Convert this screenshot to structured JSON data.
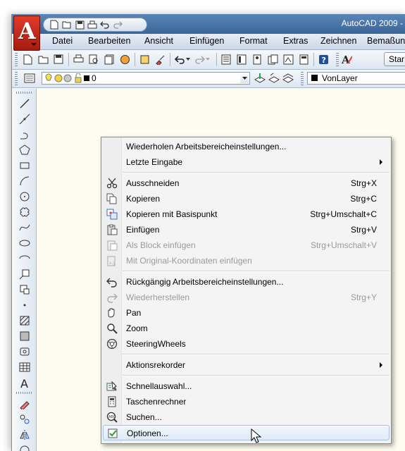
{
  "app_title": "AutoCAD 2009 -",
  "app_logo_letter": "A",
  "menu": [
    "Datei",
    "Bearbeiten",
    "Ansicht",
    "Einfügen",
    "Format",
    "Extras",
    "Zeichnen",
    "Bemaßun"
  ],
  "layer_toolbar": {
    "layer_value": "0",
    "color_value": "VonLayer"
  },
  "styles_button": "Star",
  "context_menu": {
    "items": [
      {
        "label": "Wiederholen Arbeitsbereicheinstellungen...",
        "shortcut": "",
        "icon": "",
        "submenu": false,
        "enabled": true
      },
      {
        "label": "Letzte Eingabe",
        "shortcut": "",
        "icon": "",
        "submenu": true,
        "enabled": true
      },
      {
        "label": "Ausschneiden",
        "shortcut": "Strg+X",
        "icon": "scissors-icon",
        "submenu": false,
        "enabled": true
      },
      {
        "label": "Kopieren",
        "shortcut": "Strg+C",
        "icon": "copy-icon",
        "submenu": false,
        "enabled": true
      },
      {
        "label": "Kopieren mit Basispunkt",
        "shortcut": "Strg+Umschalt+C",
        "icon": "copy-basepoint-icon",
        "submenu": false,
        "enabled": true
      },
      {
        "label": "Einfügen",
        "shortcut": "Strg+V",
        "icon": "paste-icon",
        "submenu": false,
        "enabled": true
      },
      {
        "label": "Als Block einfügen",
        "shortcut": "Strg+Umschalt+V",
        "icon": "paste-block-icon",
        "submenu": false,
        "enabled": false
      },
      {
        "label": "Mit Original-Koordinaten einfügen",
        "shortcut": "",
        "icon": "paste-original-coords-icon",
        "submenu": false,
        "enabled": false
      },
      {
        "label": "Rückgängig Arbeitsbereicheinstellungen...",
        "shortcut": "",
        "icon": "undo-icon",
        "submenu": false,
        "enabled": true
      },
      {
        "label": "Wiederherstellen",
        "shortcut": "Strg+Y",
        "icon": "redo-icon",
        "submenu": false,
        "enabled": false
      },
      {
        "label": "Pan",
        "shortcut": "",
        "icon": "pan-hand-icon",
        "submenu": false,
        "enabled": true
      },
      {
        "label": "Zoom",
        "shortcut": "",
        "icon": "zoom-magnifier-icon",
        "submenu": false,
        "enabled": true
      },
      {
        "label": "SteeringWheels",
        "shortcut": "",
        "icon": "steering-wheels-icon",
        "submenu": false,
        "enabled": true
      },
      {
        "label": "Aktionsrekorder",
        "shortcut": "",
        "icon": "",
        "submenu": true,
        "enabled": true
      },
      {
        "label": "Schnellauswahl...",
        "shortcut": "",
        "icon": "quick-select-icon",
        "submenu": false,
        "enabled": true
      },
      {
        "label": "Taschenrechner",
        "shortcut": "",
        "icon": "calculator-icon",
        "submenu": false,
        "enabled": true
      },
      {
        "label": "Suchen...",
        "shortcut": "",
        "icon": "find-icon",
        "submenu": false,
        "enabled": true
      },
      {
        "label": "Optionen...",
        "shortcut": "",
        "icon": "options-checkbox-icon",
        "submenu": false,
        "enabled": true,
        "highlighted": true
      }
    ]
  },
  "colors": {
    "title_bar": "#3a6597",
    "app_logo": "#c8251a",
    "canvas": "#fdfcf0",
    "menu_highlight": "#dfeaf7",
    "disabled_text": "#9a9a9a"
  }
}
